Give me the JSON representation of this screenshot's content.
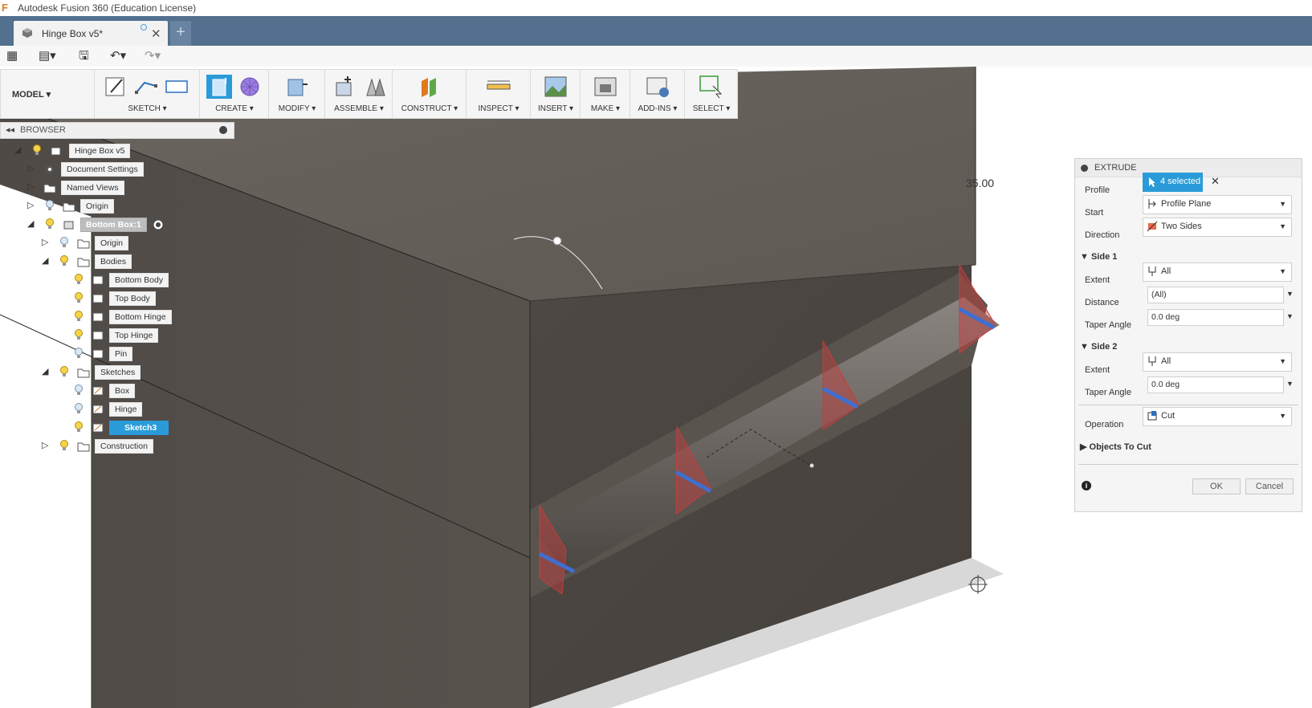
{
  "app": {
    "title": "Autodesk Fusion 360 (Education License)",
    "logo_letter": "F"
  },
  "tab": {
    "name": "Hinge Box v5*",
    "close": "✕",
    "new": "+"
  },
  "quick": {
    "grid": "▦",
    "file": "▤▾",
    "save": "🖫",
    "undo": "↶▾",
    "redo": "↷▾"
  },
  "toolbar": {
    "mode": "MODEL ▾",
    "groups": [
      "SKETCH ▾",
      "CREATE ▾",
      "MODIFY ▾",
      "ASSEMBLE ▾",
      "CONSTRUCT ▾",
      "INSPECT ▾",
      "INSERT ▾",
      "MAKE ▾",
      "ADD-INS ▾",
      "SELECT ▾"
    ]
  },
  "browser": {
    "title": "BROWSER",
    "collapse": "◂◂",
    "nodes": [
      {
        "label": "Hinge Box v5"
      },
      {
        "label": "Document Settings"
      },
      {
        "label": "Named Views"
      },
      {
        "label": "Origin"
      },
      {
        "label": "Bottom Box:1"
      },
      {
        "label": "Origin"
      },
      {
        "label": "Bodies"
      },
      {
        "label": "Bottom Body"
      },
      {
        "label": "Top Body"
      },
      {
        "label": "Bottom Hinge"
      },
      {
        "label": "Top Hinge"
      },
      {
        "label": "Pin"
      },
      {
        "label": "Sketches"
      },
      {
        "label": "Box"
      },
      {
        "label": "Hinge"
      },
      {
        "label": "Sketch3"
      },
      {
        "label": "Construction"
      }
    ]
  },
  "viewport": {
    "dimension": "35.00"
  },
  "extrude": {
    "title": "EXTRUDE",
    "profile_label": "Profile",
    "profile_value": "4 selected",
    "clear": "✕",
    "start_label": "Start",
    "start_value": "Profile Plane",
    "direction_label": "Direction",
    "direction_value": "Two Sides",
    "side1": "Side 1",
    "side1_extent_label": "Extent",
    "side1_extent_value": "All",
    "distance_label": "Distance",
    "distance_value": "(All)",
    "taper1_label": "Taper Angle",
    "taper1_value": "0.0 deg",
    "side2": "Side 2",
    "side2_extent_label": "Extent",
    "side2_extent_value": "All",
    "taper2_label": "Taper Angle",
    "taper2_value": "0.0 deg",
    "operation_label": "Operation",
    "operation_value": "Cut",
    "objects": "Objects To Cut",
    "ok": "OK",
    "cancel": "Cancel",
    "info": "i"
  },
  "colors": {
    "tabbar": "#53708f",
    "accent": "#2a9bd8",
    "model": "#5b5550",
    "profile_red": "#c83c3c",
    "profile_blue": "#3f6fd0"
  }
}
